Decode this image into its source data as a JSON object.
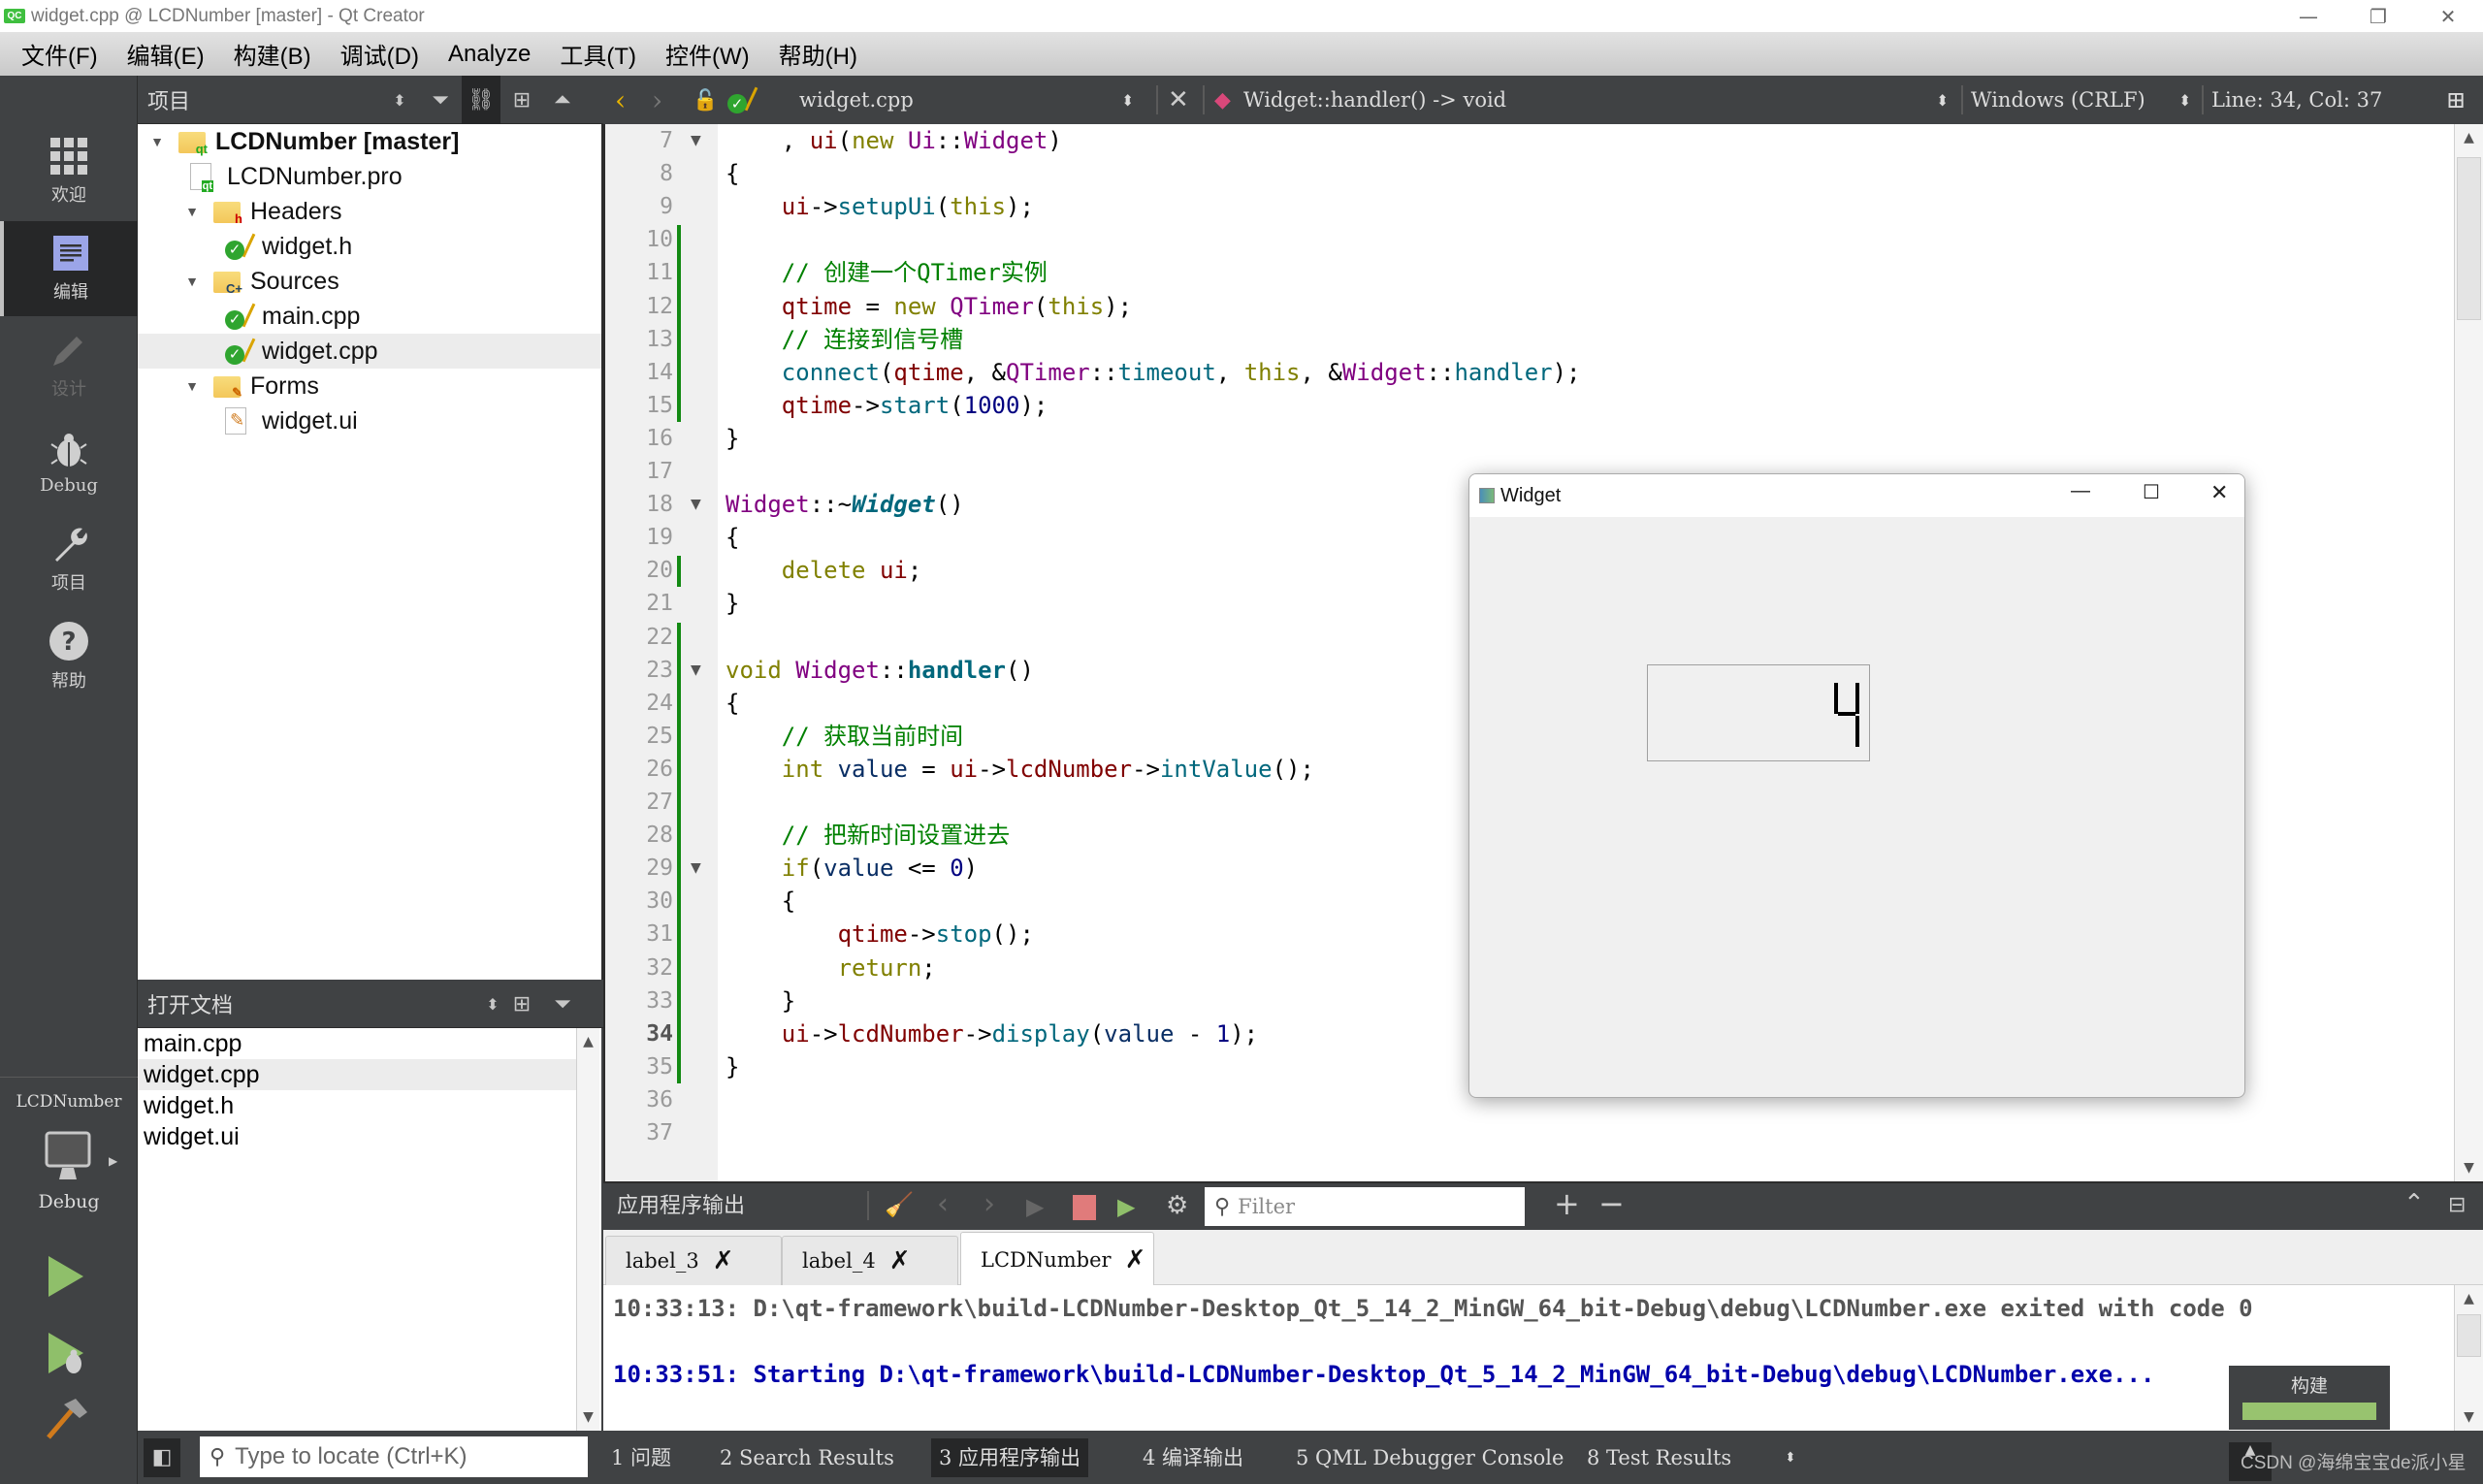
{
  "window": {
    "title": "widget.cpp @ LCDNumber [master] - Qt Creator",
    "app_icon": "QC",
    "minimize": "—",
    "restore": "❐",
    "close": "✕"
  },
  "menu": [
    "文件(F)",
    "编辑(E)",
    "构建(B)",
    "调试(D)",
    "Analyze",
    "工具(T)",
    "控件(W)",
    "帮助(H)"
  ],
  "modes": [
    {
      "label": "欢迎",
      "icon": "grid-icon",
      "state": "normal"
    },
    {
      "label": "编辑",
      "icon": "edit-document-icon",
      "state": "active"
    },
    {
      "label": "设计",
      "icon": "pencil-icon",
      "state": "disabled"
    },
    {
      "label": "Debug",
      "icon": "bug-icon",
      "state": "normal"
    },
    {
      "label": "项目",
      "icon": "wrench-icon",
      "state": "normal"
    },
    {
      "label": "帮助",
      "icon": "help-icon",
      "state": "normal"
    }
  ],
  "kit": {
    "project": "LCDNumber",
    "build": "Debug"
  },
  "project_panel": {
    "title": "项目",
    "tree": [
      {
        "label": "LCDNumber [master]",
        "level": 0,
        "expanded": true,
        "icon": "qt-project-folder-icon",
        "bold": true
      },
      {
        "label": "LCDNumber.pro",
        "level": 1,
        "icon": "pro-file-icon"
      },
      {
        "label": "Headers",
        "level": 1,
        "expanded": true,
        "icon": "headers-folder-icon"
      },
      {
        "label": "widget.h",
        "level": 2,
        "icon": "vcs-ok-file-icon"
      },
      {
        "label": "Sources",
        "level": 1,
        "expanded": true,
        "icon": "sources-folder-icon"
      },
      {
        "label": "main.cpp",
        "level": 2,
        "icon": "vcs-ok-file-icon"
      },
      {
        "label": "widget.cpp",
        "level": 2,
        "icon": "vcs-ok-file-icon",
        "selected": true
      },
      {
        "label": "Forms",
        "level": 1,
        "expanded": true,
        "icon": "forms-folder-icon"
      },
      {
        "label": "widget.ui",
        "level": 2,
        "icon": "ui-file-icon"
      }
    ]
  },
  "open_docs": {
    "title": "打开文档",
    "items": [
      "main.cpp",
      "widget.cpp",
      "widget.h",
      "widget.ui"
    ],
    "selected": "widget.cpp"
  },
  "editor_toolbar": {
    "file": "widget.cpp",
    "symbol": "Widget::handler() -> void",
    "line_ending": "Windows (CRLF)",
    "position": "Line: 34, Col: 37"
  },
  "editor": {
    "current_line": 34,
    "lines": [
      {
        "n": 7,
        "fold": true,
        "html": "    , <span class='m'>ui</span>(<span class='k'>new</span> <span class='t'>Ui</span>::<span class='t'>Widget</span>)"
      },
      {
        "n": 8,
        "html": "{"
      },
      {
        "n": 9,
        "html": "    <span class='m'>ui</span>-&gt;<span class='f'>setupUi</span>(<span class='k'>this</span>);"
      },
      {
        "n": 10,
        "html": ""
      },
      {
        "n": 11,
        "html": "    <span class='c'>// 创建一个QTimer实例</span>"
      },
      {
        "n": 12,
        "html": "    <span class='m'>qtime</span> = <span class='k'>new</span> <span class='t'>QTimer</span>(<span class='k'>this</span>);"
      },
      {
        "n": 13,
        "html": "    <span class='c'>// 连接到信号槽</span>"
      },
      {
        "n": 14,
        "html": "    <span class='f'>connect</span>(<span class='m'>qtime</span>, &amp;<span class='t'>QTimer</span>::<span class='f'>timeout</span>, <span class='k'>this</span>, &amp;<span class='t'>Widget</span>::<span class='f'>handler</span>);"
      },
      {
        "n": 15,
        "html": "    <span class='m'>qtime</span>-&gt;<span class='f'>start</span>(<span class='n'>1000</span>);"
      },
      {
        "n": 16,
        "html": "}"
      },
      {
        "n": 17,
        "html": ""
      },
      {
        "n": 18,
        "fold": true,
        "html": "<span class='t'>Widget</span>::~<span class='fi'>Widget</span>()"
      },
      {
        "n": 19,
        "html": "{"
      },
      {
        "n": 20,
        "html": "    <span class='k'>delete</span> <span class='m'>ui</span>;"
      },
      {
        "n": 21,
        "html": "}"
      },
      {
        "n": 22,
        "html": ""
      },
      {
        "n": 23,
        "fold": true,
        "html": "<span class='k'>void</span> <span class='t'>Widget</span>::<span class='fb'>handler</span>()"
      },
      {
        "n": 24,
        "html": "{"
      },
      {
        "n": 25,
        "html": "    <span class='c'>// 获取当前时间</span>"
      },
      {
        "n": 26,
        "html": "    <span class='k'>int</span> <span class='v'>value</span> = <span class='m'>ui</span>-&gt;<span class='m'>lcdNumber</span>-&gt;<span class='f'>intValue</span>();"
      },
      {
        "n": 27,
        "html": ""
      },
      {
        "n": 28,
        "html": "    <span class='c'>// 把新时间设置进去</span>"
      },
      {
        "n": 29,
        "fold": true,
        "html": "    <span class='k'>if</span>(<span class='v'>value</span> &lt;= <span class='n'>0</span>)"
      },
      {
        "n": 30,
        "html": "    {"
      },
      {
        "n": 31,
        "html": "        <span class='m'>qtime</span>-&gt;<span class='f'>stop</span>();"
      },
      {
        "n": 32,
        "html": "        <span class='k'>return</span>;"
      },
      {
        "n": 33,
        "html": "    }"
      },
      {
        "n": 34,
        "html": "    <span class='m'>ui</span>-&gt;<span class='m'>lcdNumber</span>-&gt;<span class='f'>display</span>(<span class='v'>value</span> - <span class='n'>1</span>);"
      },
      {
        "n": 35,
        "html": "}"
      },
      {
        "n": 36,
        "html": ""
      },
      {
        "n": 37,
        "html": ""
      }
    ],
    "changed_ranges": [
      [
        10,
        15
      ],
      [
        20,
        20
      ],
      [
        22,
        35
      ]
    ]
  },
  "output_pane": {
    "title": "应用程序输出",
    "filter_placeholder": "Filter",
    "tabs": [
      {
        "label": "label_3",
        "active": false
      },
      {
        "label": "label_4",
        "active": false
      },
      {
        "label": "LCDNumber",
        "active": true
      }
    ],
    "lines": [
      {
        "text": "10:33:13: D:\\qt-framework\\build-LCDNumber-Desktop_Qt_5_14_2_MinGW_64_bit-Debug\\debug\\LCDNumber.exe exited with code 0",
        "color": "#555555"
      },
      {
        "text": "10:33:51: Starting D:\\qt-framework\\build-LCDNumber-Desktop_Qt_5_14_2_MinGW_64_bit-Debug\\debug\\LCDNumber.exe...",
        "color": "#0000aa"
      }
    ]
  },
  "status_bar": {
    "locator_placeholder": "Type to locate (Ctrl+K)",
    "panes": [
      {
        "label": "1  问题",
        "active": false
      },
      {
        "label": "2  Search Results",
        "active": false
      },
      {
        "label": "3  应用程序输出",
        "active": true
      },
      {
        "label": "4  编译输出",
        "active": false
      },
      {
        "label": "5  QML Debugger Console",
        "active": false
      },
      {
        "label": "8  Test Results",
        "active": false
      }
    ]
  },
  "build_progress": {
    "label": "构建",
    "progress": 1.0,
    "color": "#98c36f"
  },
  "watermark": "CSDN @海绵宝宝de派小星",
  "widget_app": {
    "title": "Widget",
    "lcd_value": "4"
  },
  "colors": {
    "dark_panel": "#404244",
    "active_mode": "#262728",
    "change_marker": "#138a13",
    "run_green": "#8fbf6a",
    "stop_red": "#e07b7b"
  }
}
